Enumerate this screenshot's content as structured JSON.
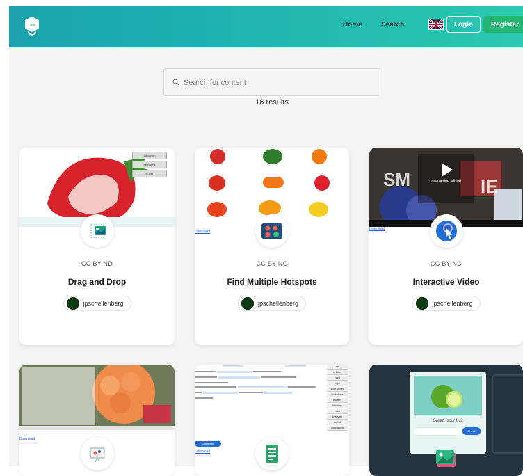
{
  "nav": {
    "home": "Home",
    "search": "Search",
    "login": "Login",
    "register": "Register",
    "logo_text": "Lumi"
  },
  "search": {
    "placeholder": "Search for content",
    "results": "16 results"
  },
  "cards": [
    {
      "license": "CC BY-ND",
      "title": "Drag and Drop",
      "author": "jpschellenberg",
      "icon": "drag-and-drop-icon",
      "thumb_labels": [
        "Vacutrum",
        "Frequens",
        "Ruber"
      ]
    },
    {
      "license": "CC BY-NC",
      "title": "Find Multiple Hotspots",
      "author": "jpschellenberg",
      "icon": "find-multiple-hotspots-icon",
      "download": "Download"
    },
    {
      "license": "CC BY-NC",
      "title": "Interactive Video",
      "author": "jpschellenberg",
      "icon": "interactive-video-icon",
      "download": "Download",
      "video_label": "Interactive Video"
    },
    {
      "icon": "presentation-icon",
      "download": "Download"
    },
    {
      "icon": "fill-in-blanks-icon",
      "download": "Download",
      "button": "Show Info",
      "words": [
        "on",
        "in Land",
        "novel",
        "copy",
        "short stories",
        "bookstores",
        "traveled",
        "literature",
        "main",
        "character",
        "author",
        "adaptations"
      ]
    },
    {
      "icon": "image-choice-icon",
      "caption": "Green, sour fruit",
      "check": "Check"
    }
  ],
  "colors": {
    "nav_start": "#1aa2ae",
    "nav_end": "#2bc9b0",
    "register": "#22b573",
    "background": "#f4f4f4"
  }
}
